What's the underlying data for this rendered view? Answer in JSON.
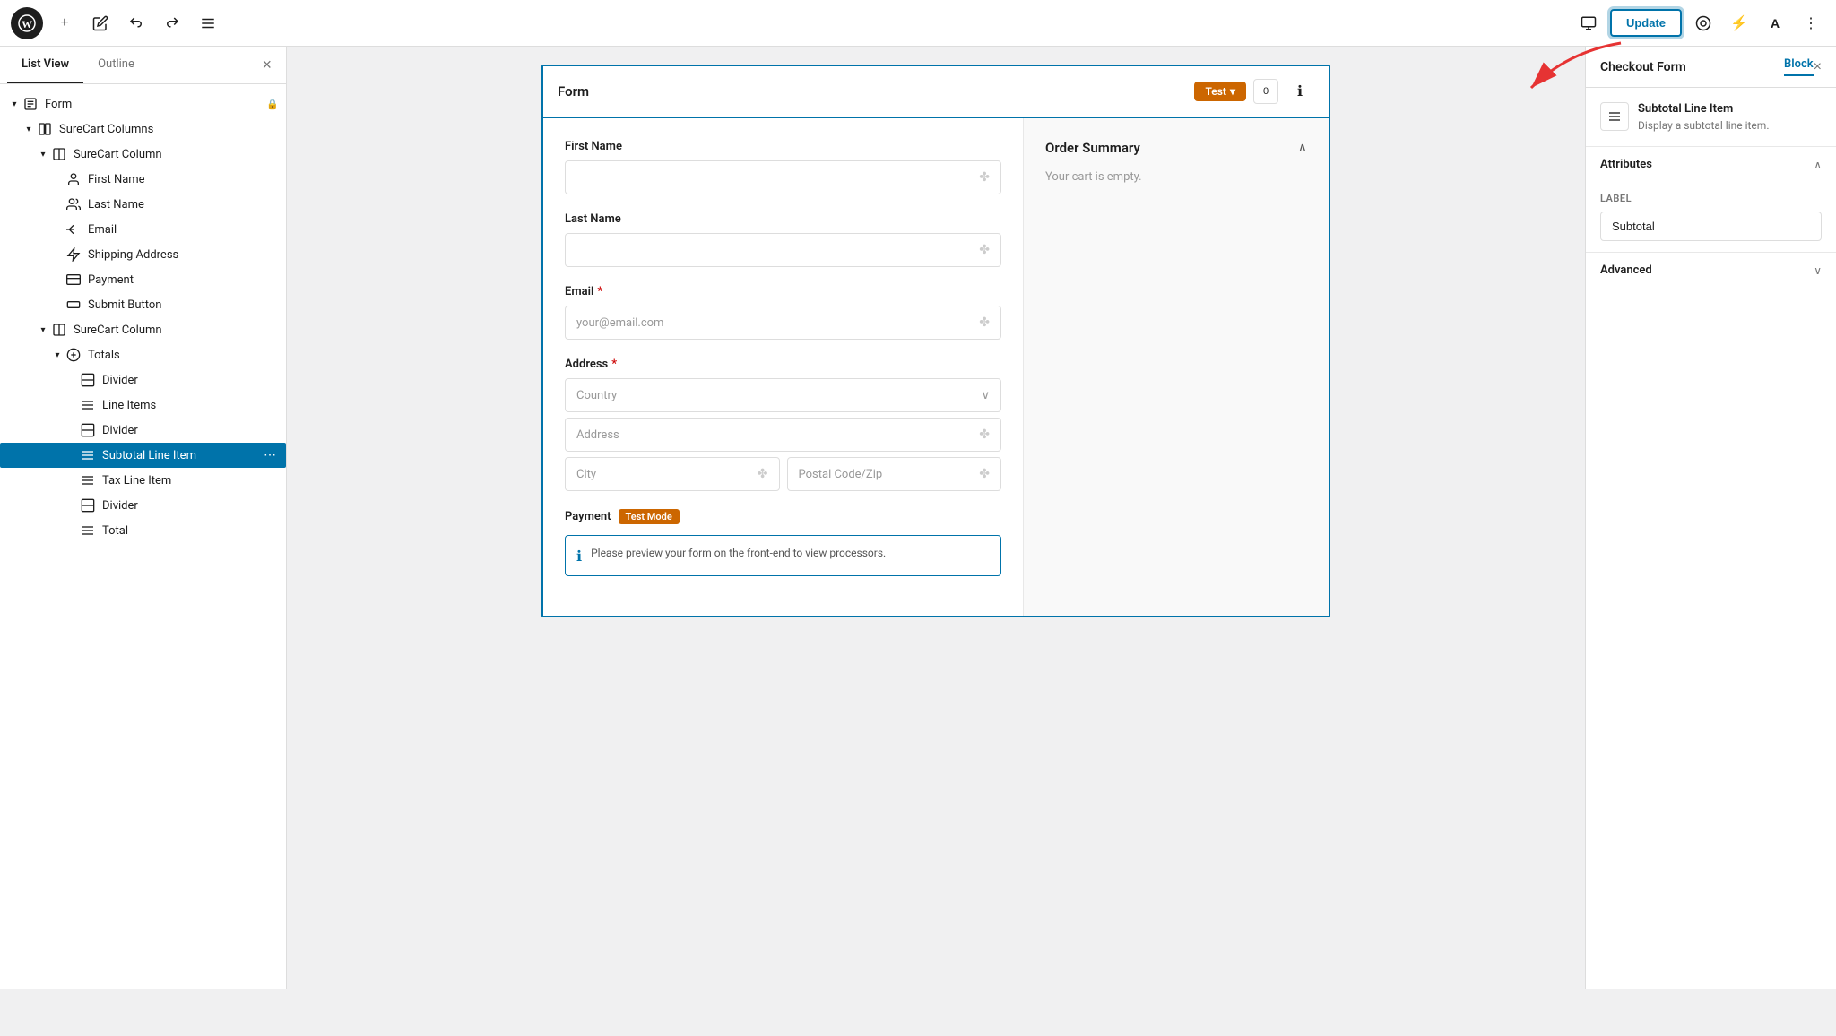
{
  "toolbar": {
    "wp_logo": "W",
    "add_label": "+",
    "edit_label": "✏",
    "undo_label": "↩",
    "redo_label": "↪",
    "list_view_label": "≡",
    "update_button": "Update",
    "view_icon": "⊡",
    "styles_icon": "▣",
    "bolt_icon": "⚡",
    "a_icon": "A",
    "more_icon": "⋮"
  },
  "left_sidebar": {
    "tab_list_view": "List View",
    "tab_outline": "Outline",
    "close": "×",
    "tree": [
      {
        "id": "form",
        "level": 0,
        "toggle": "▾",
        "icon": "☰",
        "label": "Form",
        "has_lock": true,
        "indent": 0
      },
      {
        "id": "surecart-columns-1",
        "level": 1,
        "toggle": "▾",
        "icon": "⊞",
        "label": "SureCart Columns",
        "indent": 1
      },
      {
        "id": "surecart-column-1",
        "level": 2,
        "toggle": "▾",
        "icon": "▥",
        "label": "SureCart Column",
        "indent": 2
      },
      {
        "id": "first-name",
        "level": 3,
        "toggle": "",
        "icon": "👤",
        "label": "First Name",
        "indent": 3
      },
      {
        "id": "last-name",
        "level": 3,
        "toggle": "",
        "icon": "👥",
        "label": "Last Name",
        "indent": 3
      },
      {
        "id": "email",
        "level": 3,
        "toggle": "",
        "icon": "✏",
        "label": "Email",
        "indent": 3
      },
      {
        "id": "shipping-address",
        "level": 3,
        "toggle": "",
        "icon": "✦",
        "label": "Shipping Address",
        "indent": 3
      },
      {
        "id": "payment",
        "level": 3,
        "toggle": "",
        "icon": "💳",
        "label": "Payment",
        "indent": 3
      },
      {
        "id": "submit-button",
        "level": 3,
        "toggle": "",
        "icon": "▭",
        "label": "Submit Button",
        "indent": 3
      },
      {
        "id": "surecart-column-2",
        "level": 2,
        "toggle": "▾",
        "icon": "▥",
        "label": "SureCart Column",
        "indent": 2
      },
      {
        "id": "totals",
        "level": 3,
        "toggle": "▾",
        "icon": "◎",
        "label": "Totals",
        "indent": 3
      },
      {
        "id": "divider-1",
        "level": 4,
        "toggle": "",
        "icon": "⊟",
        "label": "Divider",
        "indent": 4
      },
      {
        "id": "line-items",
        "level": 4,
        "toggle": "",
        "icon": "≡",
        "label": "Line Items",
        "indent": 4
      },
      {
        "id": "divider-2",
        "level": 4,
        "toggle": "",
        "icon": "⊟",
        "label": "Divider",
        "indent": 4
      },
      {
        "id": "subtotal-line-item",
        "level": 4,
        "toggle": "",
        "icon": "≡",
        "label": "Subtotal Line Item",
        "indent": 4,
        "selected": true
      },
      {
        "id": "tax-line-item",
        "level": 4,
        "toggle": "",
        "icon": "≡",
        "label": "Tax Line Item",
        "indent": 4
      },
      {
        "id": "divider-3",
        "level": 4,
        "toggle": "",
        "icon": "⊟",
        "label": "Divider",
        "indent": 4
      },
      {
        "id": "total",
        "level": 4,
        "toggle": "",
        "icon": "≡",
        "label": "Total",
        "indent": 4
      }
    ]
  },
  "canvas": {
    "form_title": "Form",
    "test_badge": "Test",
    "test_badge_icon": "▾",
    "first_name_label": "First Name",
    "last_name_label": "Last Name",
    "email_label": "Email",
    "email_required": "*",
    "email_placeholder": "your@email.com",
    "address_label": "Address",
    "address_required": "*",
    "country_placeholder": "Country",
    "address_placeholder": "Address",
    "city_placeholder": "City",
    "postal_placeholder": "Postal Code/Zip",
    "payment_label": "Payment",
    "test_mode_badge": "Test Mode",
    "payment_notice": "Please preview your form on the front-end to view processors.",
    "order_summary_title": "Order Summary",
    "order_summary_toggle": "∧",
    "order_summary_empty": "Your cart is empty."
  },
  "right_sidebar": {
    "title_checkout_form": "Checkout Form",
    "tab_block": "Block",
    "close": "×",
    "block_icon": "≡",
    "block_name": "Subtotal Line Item",
    "block_desc": "Display a subtotal line item.",
    "attributes_title": "Attributes",
    "attributes_open": "∧",
    "label_field_title": "LABEL",
    "label_field_value": "Subtotal",
    "advanced_title": "Advanced",
    "advanced_toggle": "∨"
  }
}
